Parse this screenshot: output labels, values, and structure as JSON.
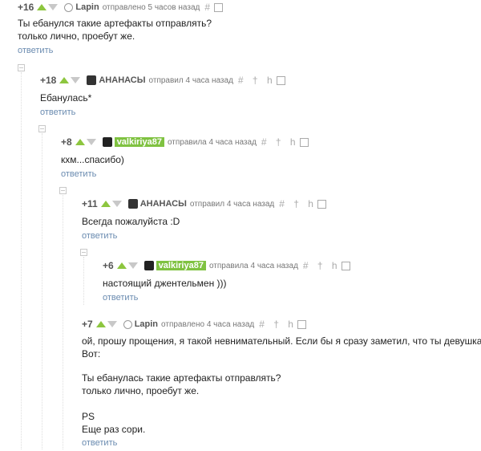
{
  "comments": [
    {
      "rating": "+16",
      "user": "Lapin",
      "meta": "отправлено 5 часов назад",
      "lines": [
        "Ты ебанулся такие артефакты отправлять?",
        "только лично, проебут же."
      ],
      "reply": "ответить"
    },
    {
      "rating": "+18",
      "user": "АНАНАСЫ",
      "meta": "отправил 4 часа назад",
      "lines": [
        "Ебанулась*"
      ],
      "reply": "ответить"
    },
    {
      "rating": "+8",
      "user": "valkiriya87",
      "meta": "отправила 4 часа назад",
      "lines": [
        "кхм...спасибо)"
      ],
      "reply": "ответить"
    },
    {
      "rating": "+11",
      "user": "АНАНАСЫ",
      "meta": "отправил 4 часа назад",
      "lines": [
        "Всегда пожалуйста :D"
      ],
      "reply": "ответить"
    },
    {
      "rating": "+6",
      "user": "valkiriya87",
      "meta": "отправила 4 часа назад",
      "lines": [
        "настоящий джентельмен )))"
      ],
      "reply": "ответить"
    },
    {
      "rating": "+7",
      "user": "Lapin",
      "meta": "отправлено 4 часа назад",
      "lines": [
        "ой, прошу прощения, я такой невнимательный. Если бы я сразу заметил, что ты девушка...",
        "Вот:",
        "",
        "Ты ебанулась такие артефакты отправлять?",
        "только лично, проебут же.",
        "",
        "PS",
        "Еще раз сори."
      ],
      "reply": "ответить"
    }
  ],
  "icons": {
    "up": "upvote-arrow-icon",
    "down": "downvote-arrow-icon",
    "tools": "comment-tools-icons"
  },
  "colors": {
    "up": "#8dc63f",
    "highlight": "#7fc241",
    "link": "#6a8bb0"
  }
}
